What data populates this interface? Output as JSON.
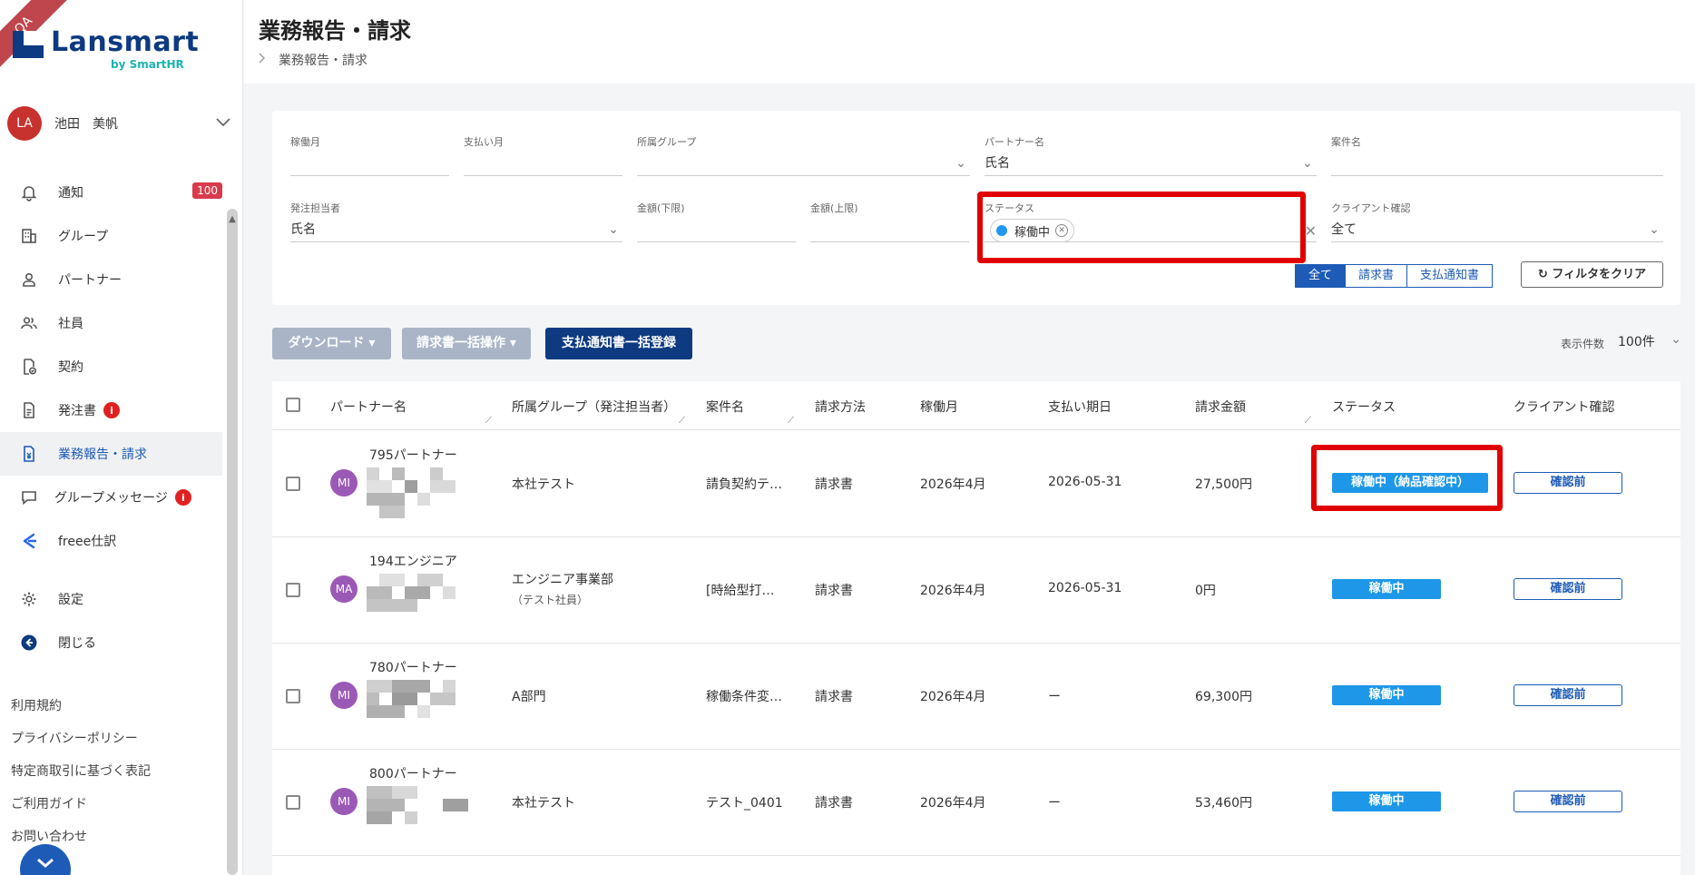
{
  "brand": {
    "ribbon": "QA",
    "logo": "Lansmart",
    "logo_sub": "by SmartHR"
  },
  "user": {
    "initials": "LA",
    "name": "池田　美帆"
  },
  "nav": {
    "notifications": {
      "label": "通知",
      "count": "100"
    },
    "group": {
      "label": "グループ"
    },
    "partner": {
      "label": "パートナー"
    },
    "employee": {
      "label": "社員"
    },
    "contract": {
      "label": "契約"
    },
    "purchase_order": {
      "label": "発注書",
      "badge": "i"
    },
    "work_report": {
      "label": "業務報告・請求"
    },
    "group_message": {
      "label": "グループメッセージ",
      "badge": "i"
    },
    "freee": {
      "label": "freee仕訳"
    },
    "settings": {
      "label": "設定"
    },
    "close": {
      "label": "閉じる"
    }
  },
  "footer_links": [
    "利用規約",
    "プライバシーポリシー",
    "特定商取引に基づく表記",
    "ご利用ガイド",
    "お問い合わせ"
  ],
  "header": {
    "title": "業務報告・請求",
    "breadcrumb": "業務報告・請求"
  },
  "filters": {
    "work_month": {
      "label": "稼働月",
      "value": ""
    },
    "payment_month": {
      "label": "支払い月",
      "value": ""
    },
    "group": {
      "label": "所属グループ",
      "value": ""
    },
    "partner_name": {
      "label": "パートナー名",
      "value": "氏名"
    },
    "project_name": {
      "label": "案件名",
      "value": ""
    },
    "orderer": {
      "label": "発注担当者",
      "value": "氏名"
    },
    "amount_min": {
      "label": "金額(下限)",
      "value": ""
    },
    "amount_max": {
      "label": "金額(上限)",
      "value": ""
    },
    "status": {
      "label": "ステータス",
      "chip": "稼働中"
    },
    "client_confirm": {
      "label": "クライアント確認",
      "value": "全て"
    }
  },
  "doc_type_tabs": [
    "全て",
    "請求書",
    "支払通知書"
  ],
  "clear_filter": "フィルタをクリア",
  "actions": {
    "download": "ダウンロード ▾",
    "invoice_bulk": "請求書一括操作 ▾",
    "payment_notice_bulk": "支払通知書一括登録"
  },
  "per_page": {
    "label": "表示件数",
    "value": "100件"
  },
  "table": {
    "columns": [
      "パートナー名",
      "所属グループ（発注担当者）",
      "案件名",
      "請求方法",
      "稼働月",
      "支払い期日",
      "請求金額",
      "ステータス",
      "クライアント確認"
    ],
    "rows": [
      {
        "initials": "MI",
        "partner": "795パートナー",
        "group": "本社テスト",
        "group_sub": "",
        "project": "請負契約テ…",
        "method": "請求書",
        "month": "2026年4月",
        "due": "2026-05-31",
        "amount": "27,500円",
        "status": "稼働中（納品確認中）",
        "client": "確認前"
      },
      {
        "initials": "MA",
        "partner": "194エンジニア",
        "group": "エンジニア事業部",
        "group_sub": "（テスト社員）",
        "project": "[時給型打…",
        "method": "請求書",
        "month": "2026年4月",
        "due": "2026-05-31",
        "amount": "0円",
        "status": "稼働中",
        "client": "確認前"
      },
      {
        "initials": "MI",
        "partner": "780パートナー",
        "group": "A部門",
        "group_sub": "",
        "project": "稼働条件変…",
        "method": "請求書",
        "month": "2026年4月",
        "due": "ー",
        "amount": "69,300円",
        "status": "稼働中",
        "client": "確認前"
      },
      {
        "initials": "MI",
        "partner": "800パートナー",
        "group": "本社テスト",
        "group_sub": "",
        "project": "テスト_0401",
        "method": "請求書",
        "month": "2026年4月",
        "due": "ー",
        "amount": "53,460円",
        "status": "稼働中",
        "client": "確認前"
      }
    ]
  },
  "colors": {
    "primary": "#0d3a80",
    "link": "#1d5bb7",
    "status": "#1e97e8",
    "highlight": "#e00000",
    "avatar": "#9b59b6",
    "badge": "#d93a4c"
  }
}
